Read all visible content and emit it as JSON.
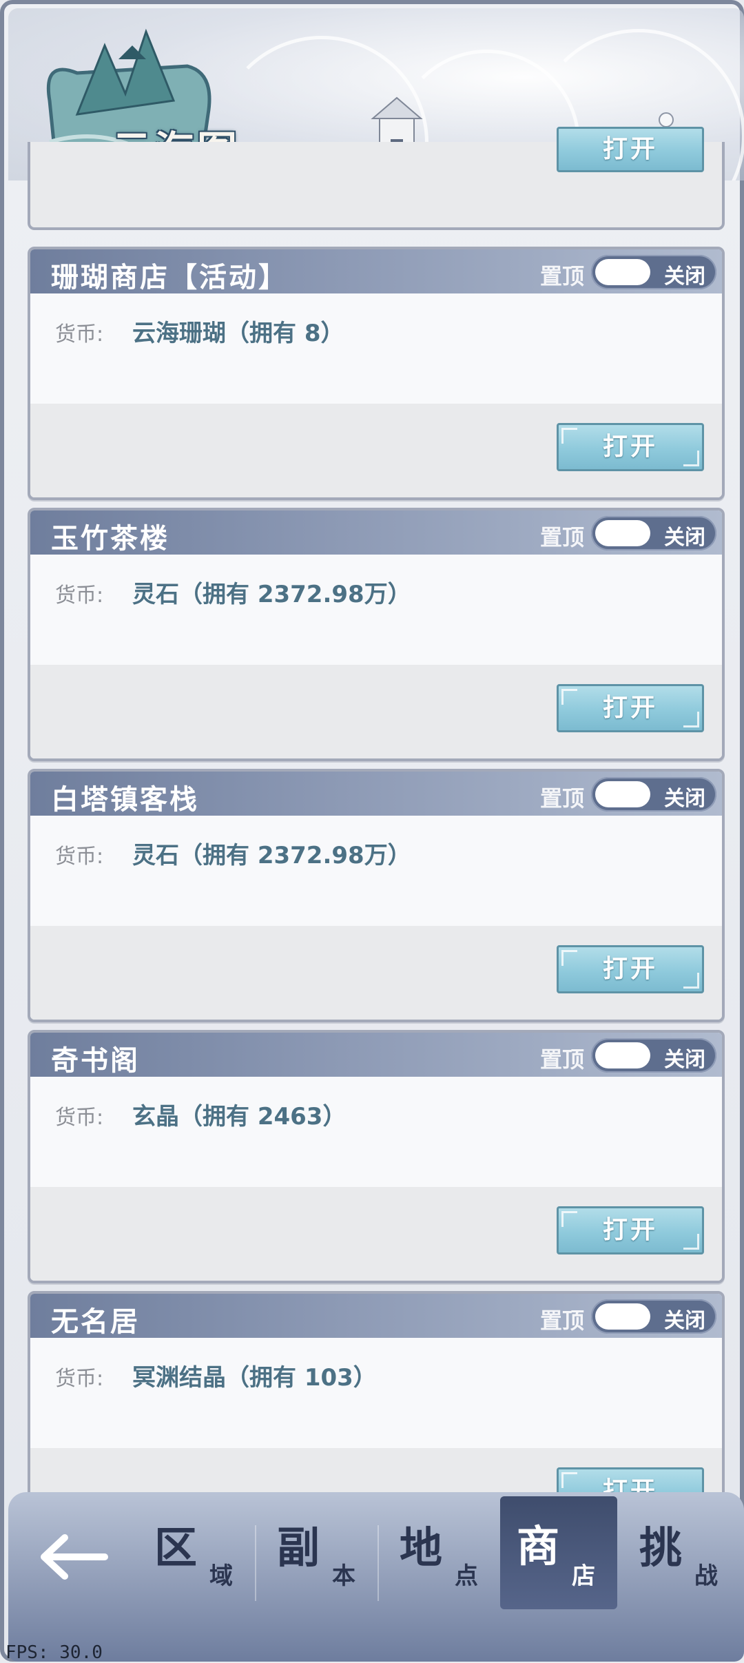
{
  "header": {
    "title": "云海图"
  },
  "top_partial_card": {
    "open_label": "打开"
  },
  "shops": [
    {
      "name": "珊瑚商店【活动】",
      "pin_label": "置顶",
      "toggle_state": "关闭",
      "currency_label": "货币:",
      "currency_value": "云海珊瑚（拥有 8）",
      "open_label": "打开"
    },
    {
      "name": "玉竹茶楼",
      "pin_label": "置顶",
      "toggle_state": "关闭",
      "currency_label": "货币:",
      "currency_value": "灵石（拥有 2372.98万）",
      "open_label": "打开"
    },
    {
      "name": "白塔镇客栈",
      "pin_label": "置顶",
      "toggle_state": "关闭",
      "currency_label": "货币:",
      "currency_value": "灵石（拥有 2372.98万）",
      "open_label": "打开"
    },
    {
      "name": "奇书阁",
      "pin_label": "置顶",
      "toggle_state": "关闭",
      "currency_label": "货币:",
      "currency_value": "玄晶（拥有 2463）",
      "open_label": "打开"
    },
    {
      "name": "无名居",
      "pin_label": "置顶",
      "toggle_state": "关闭",
      "currency_label": "货币:",
      "currency_value": "冥渊结晶（拥有 103）",
      "open_label": "打开"
    }
  ],
  "nav": {
    "back_icon": "arrow-left-icon",
    "items": [
      {
        "big": "区",
        "small": "域",
        "active": false
      },
      {
        "big": "副",
        "small": "本",
        "active": false
      },
      {
        "big": "地",
        "small": "点",
        "active": false
      },
      {
        "big": "商",
        "small": "店",
        "active": true
      },
      {
        "big": "挑",
        "small": "战",
        "active": false
      }
    ]
  },
  "fps": "FPS: 30.0",
  "colors": {
    "header_bar": "#6f7e9d",
    "button": "#8fcadc",
    "currency_text": "#4c7185",
    "nav_active": "#3f4d6d"
  }
}
